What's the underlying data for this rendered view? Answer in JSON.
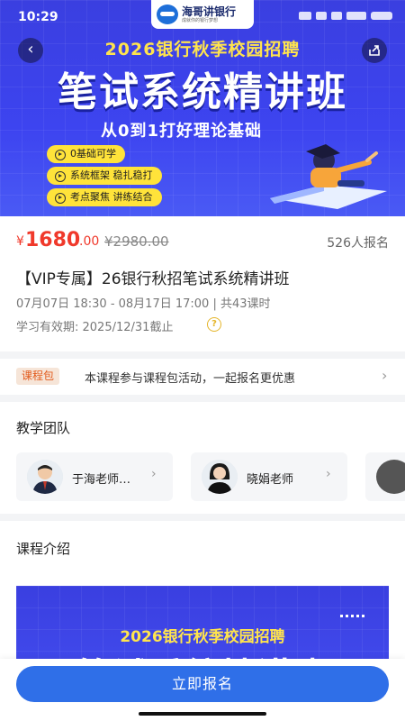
{
  "status": {
    "time": "10:29"
  },
  "brand": {
    "name": "海哥讲银行",
    "tagline": "成就你的银行梦想"
  },
  "banner": {
    "headline": "2026银行秋季校园招聘",
    "main_title": "笔试系统精讲班",
    "subtitle": "从0到1打好理论基础",
    "features": [
      "0基础可学",
      "系统框架 稳扎稳打",
      "考点聚焦 讲练结合"
    ]
  },
  "course": {
    "currency": "¥",
    "price": "1680",
    "price_decimal": ".00",
    "original_price": "¥2980.00",
    "enrolled": "526人报名",
    "title": "【VIP专属】26银行秋招笔试系统精讲班",
    "schedule": "07月07日 18:30 - 08月17日 17:00 | 共43课时",
    "validity": "学习有效期: 2025/12/31截止",
    "help_glyph": "?"
  },
  "package": {
    "badge": "课程包",
    "text": "本课程参与课程包活动，一起报名更优惠",
    "arrow": "›"
  },
  "team": {
    "title": "教学团队",
    "teachers": [
      {
        "name": "于海老师…"
      },
      {
        "name": "晓娟老师"
      }
    ],
    "arrow": "›"
  },
  "intro": {
    "title": "课程介绍",
    "image_headline": "2026银行秋季校园招聘",
    "image_title": "笔试系统精讲班"
  },
  "cta": {
    "label": "立即报名"
  },
  "nav": {
    "back_glyph": "‹"
  },
  "colors": {
    "primary": "#2f6fe8",
    "price": "#f0392b",
    "banner": "#3d44f0",
    "highlight": "#ffe33a"
  }
}
